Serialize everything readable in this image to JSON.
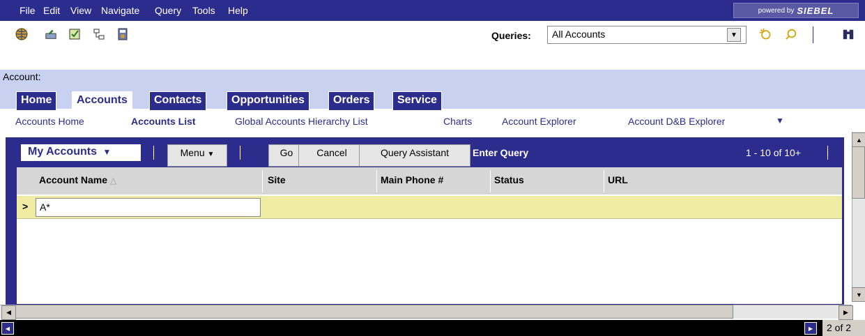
{
  "menubar": {
    "items": [
      "File",
      "Edit",
      "View",
      "Navigate",
      "Query",
      "Tools",
      "Help"
    ],
    "powered_by": "powered by",
    "brand": "SIEBEL"
  },
  "toolbar": {
    "icons": [
      "globe-icon",
      "sync-icon",
      "checklist-icon",
      "network-icon",
      "calculator-icon"
    ],
    "queries_label": "Queries:",
    "queries_value": "All Accounts",
    "right_icons": [
      "new-query-icon",
      "search-icon",
      "binoculars-icon"
    ]
  },
  "account_bar": {
    "label": "Account:"
  },
  "tabs": [
    {
      "label": "Home",
      "active": false
    },
    {
      "label": "Accounts",
      "active": true
    },
    {
      "label": "Contacts",
      "active": false
    },
    {
      "label": "Opportunities",
      "active": false
    },
    {
      "label": "Orders",
      "active": false
    },
    {
      "label": "Service",
      "active": false
    }
  ],
  "subnav": [
    {
      "label": "Accounts Home",
      "active": false
    },
    {
      "label": "Accounts List",
      "active": true
    },
    {
      "label": "Global Accounts Hierarchy List",
      "active": false
    },
    {
      "label": "Charts",
      "active": false
    },
    {
      "label": "Account Explorer",
      "active": false
    },
    {
      "label": "Account D&B Explorer",
      "active": false
    }
  ],
  "applet": {
    "visibility": "My Accounts",
    "menu": "Menu",
    "go": "Go",
    "cancel": "Cancel",
    "query_assistant": "Query Assistant",
    "mode": "Enter Query",
    "paging": "1 - 10 of 10+"
  },
  "grid": {
    "columns": [
      "Account Name",
      "Site",
      "Main Phone #",
      "Status",
      "URL"
    ],
    "sort_indicator": "△",
    "query_value": "A*",
    "row_indicator": ">"
  },
  "status": {
    "page": "2 of 2"
  },
  "colors": {
    "navy": "#2c2c8c",
    "light_blue": "#c9d1f0",
    "query_row": "#f1eca4"
  }
}
